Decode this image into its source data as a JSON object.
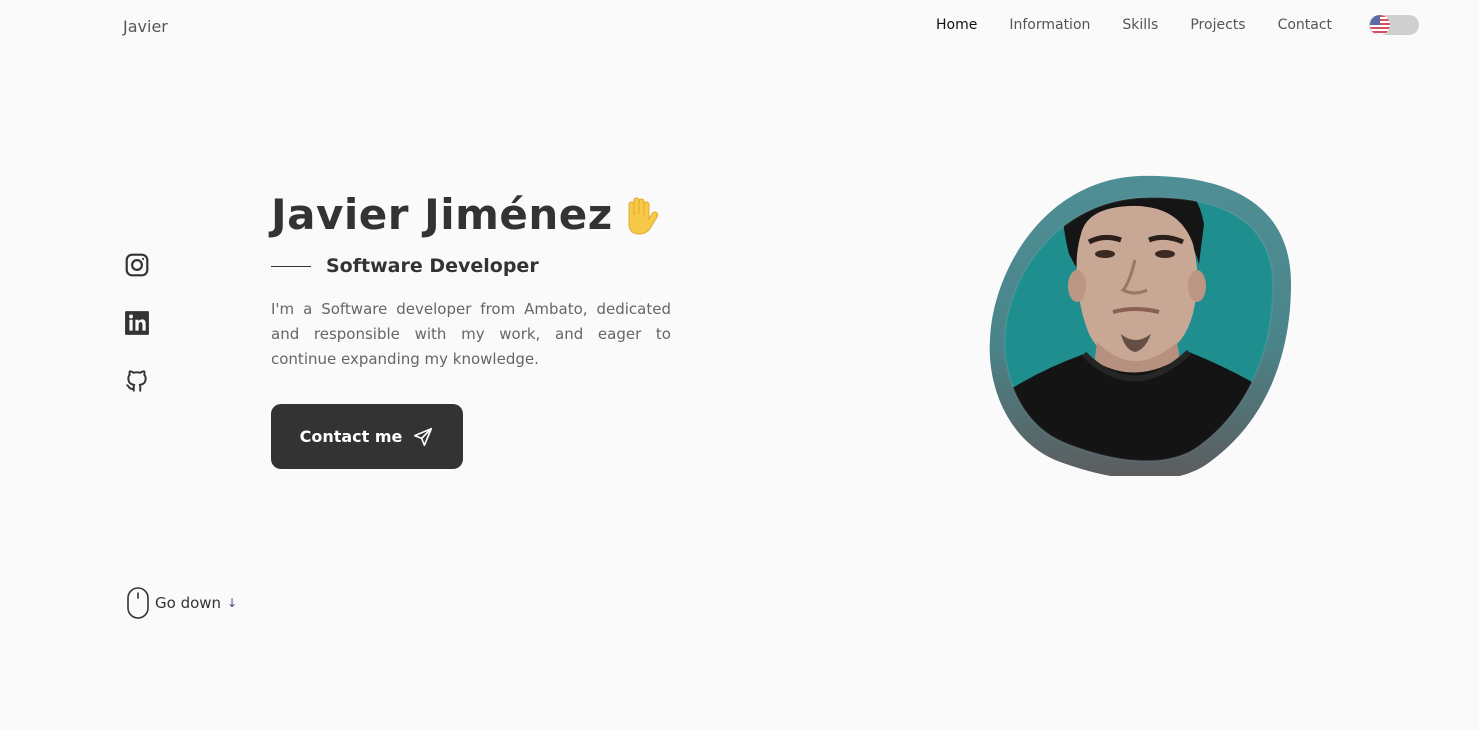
{
  "header": {
    "logo": "Javier",
    "nav": [
      {
        "label": "Home",
        "active": true
      },
      {
        "label": "Information",
        "active": false
      },
      {
        "label": "Skills",
        "active": false
      },
      {
        "label": "Projects",
        "active": false
      },
      {
        "label": "Contact",
        "active": false
      }
    ],
    "language_toggle_icon": "us-flag-icon"
  },
  "social": {
    "icons": [
      "instagram-icon",
      "linkedin-icon",
      "github-icon"
    ]
  },
  "hero": {
    "title": "Javier Jiménez",
    "title_emoji": "waving-hand-icon",
    "subtitle": "Software Developer",
    "description": "I'm a Software developer from Ambato, dedicated and responsible with my work, and eager to continue expanding my knowledge.",
    "contact_button": "Contact me",
    "contact_icon": "send-icon",
    "photo_icon": "profile-photo"
  },
  "scroll": {
    "label": "Go down",
    "mouse_icon": "mouse-icon",
    "arrow_icon": "arrow-down-icon"
  },
  "colors": {
    "background": "#fafafa",
    "text": "#333333",
    "muted_text": "#666666",
    "button_bg": "#333333",
    "blob_teal": "#4a8e93",
    "blob_dark": "#5a5a5a",
    "photo_teal": "#1a8b8d"
  }
}
